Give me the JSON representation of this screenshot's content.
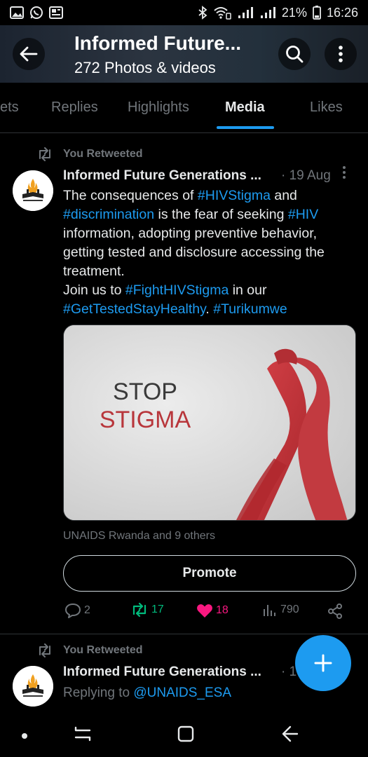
{
  "status_bar": {
    "battery": "21%",
    "time": "16:26",
    "left_icons": [
      "gallery-icon",
      "whatsapp-icon",
      "news-icon"
    ],
    "right_icons": [
      "bluetooth-icon",
      "wifi-icon",
      "signal-icon",
      "signal-icon",
      "battery-icon"
    ]
  },
  "header": {
    "title": "Informed Future...",
    "subtitle": "272 Photos & videos"
  },
  "tabs": [
    {
      "label": "ets"
    },
    {
      "label": "Replies"
    },
    {
      "label": "Highlights"
    },
    {
      "label": "Media",
      "active": true
    },
    {
      "label": "Likes"
    }
  ],
  "tweet1": {
    "retweet_label": "You Retweeted",
    "name": "Informed Future Generations ...",
    "date": "· 19 Aug",
    "text": {
      "p1": "The consequences of ",
      "tag1": "#HIVStigma",
      "p2": " and ",
      "tag2": "#discrimination",
      "p3": " is the fear of seeking ",
      "tag3": "#HIV",
      "p4": " information, adopting preventive behavior, getting tested and disclosure accessing the treatment.",
      "p5": "Join us to ",
      "tag4": "#FightHIVStigma",
      "p6": " in our ",
      "tag5": "#GetTestedStayHealthy",
      "p7": ". ",
      "tag6": "#Turikumwe"
    },
    "media": {
      "line1": "STOP",
      "line2": "STIGMA",
      "ribbon_color": "#c9343a"
    },
    "social_context": "UNAIDS Rwanda and 9 others",
    "promote_label": "Promote",
    "stats": {
      "replies": "2",
      "retweets": "17",
      "likes": "18",
      "views": "790"
    }
  },
  "tweet2": {
    "retweet_label": "You Retweeted",
    "name": "Informed Future Generations ...",
    "date": "· 1",
    "reply_prefix": "Replying to ",
    "reply_handle": "@UNAIDS_ESA"
  },
  "colors": {
    "accent": "#1d9bf0",
    "retweet_green": "#00ba7c",
    "like_pink": "#f91880",
    "muted": "#71767b"
  }
}
